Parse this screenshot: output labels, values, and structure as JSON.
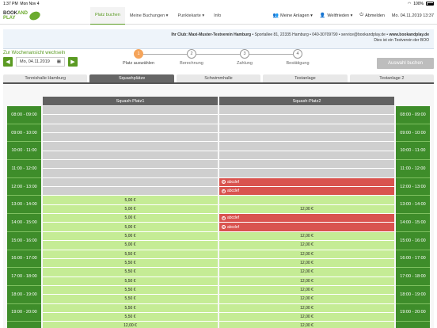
{
  "status": {
    "time": "1:37 PM",
    "date": "Mon Nov 4",
    "battery": "100%"
  },
  "nav": {
    "logo_a": "BOOK",
    "logo_b": "AND",
    "logo_c": "PLAY",
    "links": [
      "Platz buchen",
      "Meine Buchungen ▾",
      "Punktekarte ▾",
      "Info"
    ],
    "facilities": "Meine Anlagen ▾",
    "user": "Weltfrieden ▾",
    "logout": "Abmelden",
    "datetime": "Mo. 04.11.2019 13:37"
  },
  "club": {
    "line1_bold": "Ihr Club: Maxi-Muster-Testverein Hamburg",
    "line1_rest": " • Sportallee 81, 22335 Hamburg • 040-30709790 • service@bookandplay.de • ",
    "line1_url": "www.bookandplay.de",
    "line2": "Dies ist ein Testverein der BOO"
  },
  "week_link": "Zur Wochenansicht wechseln",
  "date_value": "Mo, 04.11.2019",
  "steps": [
    {
      "num": "1",
      "label": "Platz auswählen"
    },
    {
      "num": "2",
      "label": "Berechnung"
    },
    {
      "num": "3",
      "label": "Zahlung"
    },
    {
      "num": "4",
      "label": "Bestätigung"
    }
  ],
  "book_button": "Auswahl buchen",
  "tabs": [
    "Tennishalle Hamburg",
    "Squashplätze",
    "Schwimmhalle",
    "Testanlage",
    "Testanlage 2"
  ],
  "courts": [
    "Squash-Platz1",
    "Squash-Platz2"
  ],
  "times": [
    "08:00 - 09:00",
    "09:00 - 10:00",
    "10:00 - 11:00",
    "11:00 - 12:00",
    "12:00 - 13:00",
    "13:00 - 14:00",
    "14:00 - 15:00",
    "15:00 - 16:00",
    "16:00 - 17:00",
    "17:00 - 18:00",
    "18:00 - 19:00",
    "19:00 - 20:00",
    "20:00 - 21:00"
  ],
  "court1": [
    "",
    "",
    "",
    "",
    "",
    "",
    "",
    "",
    "",
    "",
    "5,00 €",
    "5,00 €",
    "5,00 €",
    "5,00 €",
    "5,00 €",
    "5,00 €",
    "5,50 €",
    "5,50 €",
    "5,50 €",
    "5,50 €",
    "5,50 €",
    "5,50 €",
    "5,50 €",
    "5,50 €",
    "12,00 €"
  ],
  "court2": [
    "",
    "",
    "",
    "",
    "",
    "",
    "",
    "",
    "abcdef",
    "abcdef",
    "",
    "12,00 €",
    "abcdef",
    "abcdef",
    "12,00 €",
    "12,00 €",
    "12,00 €",
    "12,00 €",
    "12,00 €",
    "12,00 €",
    "12,00 €",
    "12,00 €",
    "12,00 €",
    "12,00 €",
    "12,00 €"
  ]
}
